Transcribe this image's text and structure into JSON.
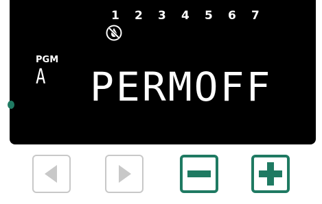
{
  "display": {
    "day_numbers": [
      "1",
      "2",
      "3",
      "4",
      "5",
      "6",
      "7"
    ],
    "program_label": "PGM",
    "program_letter": "A",
    "main_text": "PERMOFF"
  },
  "icons": {
    "no_water": "no-water-drop-icon",
    "left": "arrow-left-icon",
    "right": "arrow-right-icon",
    "minus": "minus-icon",
    "plus": "plus-icon"
  },
  "colors": {
    "lcd_background": "#000000",
    "lcd_text": "#ffffff",
    "accent_green": "#1f7a62",
    "inactive_button": "#c8c8c8"
  }
}
